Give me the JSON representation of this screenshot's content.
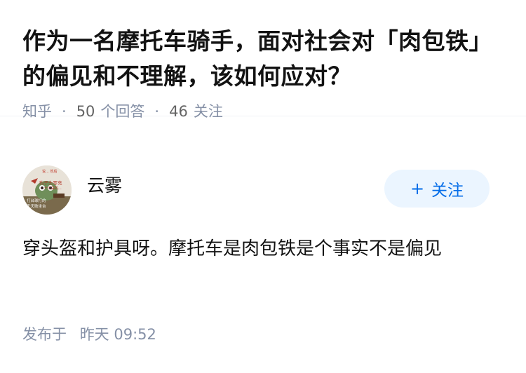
{
  "question": {
    "title": "作为一名摩托车骑手，面对社会对「肉包铁」的偏见和不理解，该如何应对？",
    "source": "知乎",
    "answer_count": "50",
    "answer_label": "个回答",
    "follower_count": "46",
    "follower_label": "关注"
  },
  "answer": {
    "author_name": "云雾",
    "follow_button_plus": "+",
    "follow_button_label": "关注",
    "content": "穿头盔和护具呀。摩托车是肉包铁是个事实不是偏见",
    "time_label": "发布于",
    "time_value": "昨天 09:52"
  },
  "avatar": {
    "caption_top": "说... 然后",
    "caption_line1": "豹子头零充",
    "caption_line2": "八十万禁的...",
    "caption_line3": "打台球打的",
    "caption_line4": "夭夭败坐台"
  },
  "colors": {
    "accent": "#056de8",
    "follow_bg": "#ebf5ff",
    "meta": "#8590a6"
  }
}
